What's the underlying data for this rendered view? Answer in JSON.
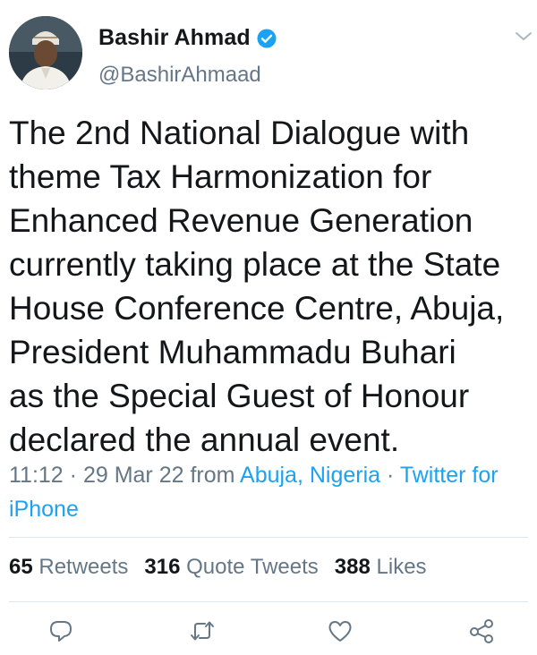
{
  "author": {
    "display_name": "Bashir Ahmad",
    "handle": "@BashirAhmaad",
    "verified_icon": "verified-badge-icon"
  },
  "tweet": {
    "lines": [
      "The 2nd National Dialogue with",
      "theme Tax Harmonization for",
      "Enhanced Revenue Generation",
      "currently taking place at the State",
      "House Conference Centre, Abuja,",
      "President Muhammadu Buhari",
      "as the Special Guest of Honour",
      "declared the annual event."
    ]
  },
  "meta": {
    "time": "11:12",
    "sep1": " · ",
    "date": "29 Mar 22",
    "from": " from ",
    "location": "Abuja, Nigeria",
    "sep2": " · ",
    "source": "Twitter for iPhone"
  },
  "stats": {
    "retweets_count": "65",
    "retweets_label": "Retweets",
    "quotes_count": "316",
    "quotes_label": "Quote Tweets",
    "likes_count": "388",
    "likes_label": "Likes"
  },
  "actions": [
    "reply-icon",
    "retweet-icon",
    "like-icon",
    "share-icon"
  ],
  "colors": {
    "accent": "#1da1f2",
    "text": "#14171a",
    "muted": "#657786",
    "divider": "#e1e8ed"
  }
}
